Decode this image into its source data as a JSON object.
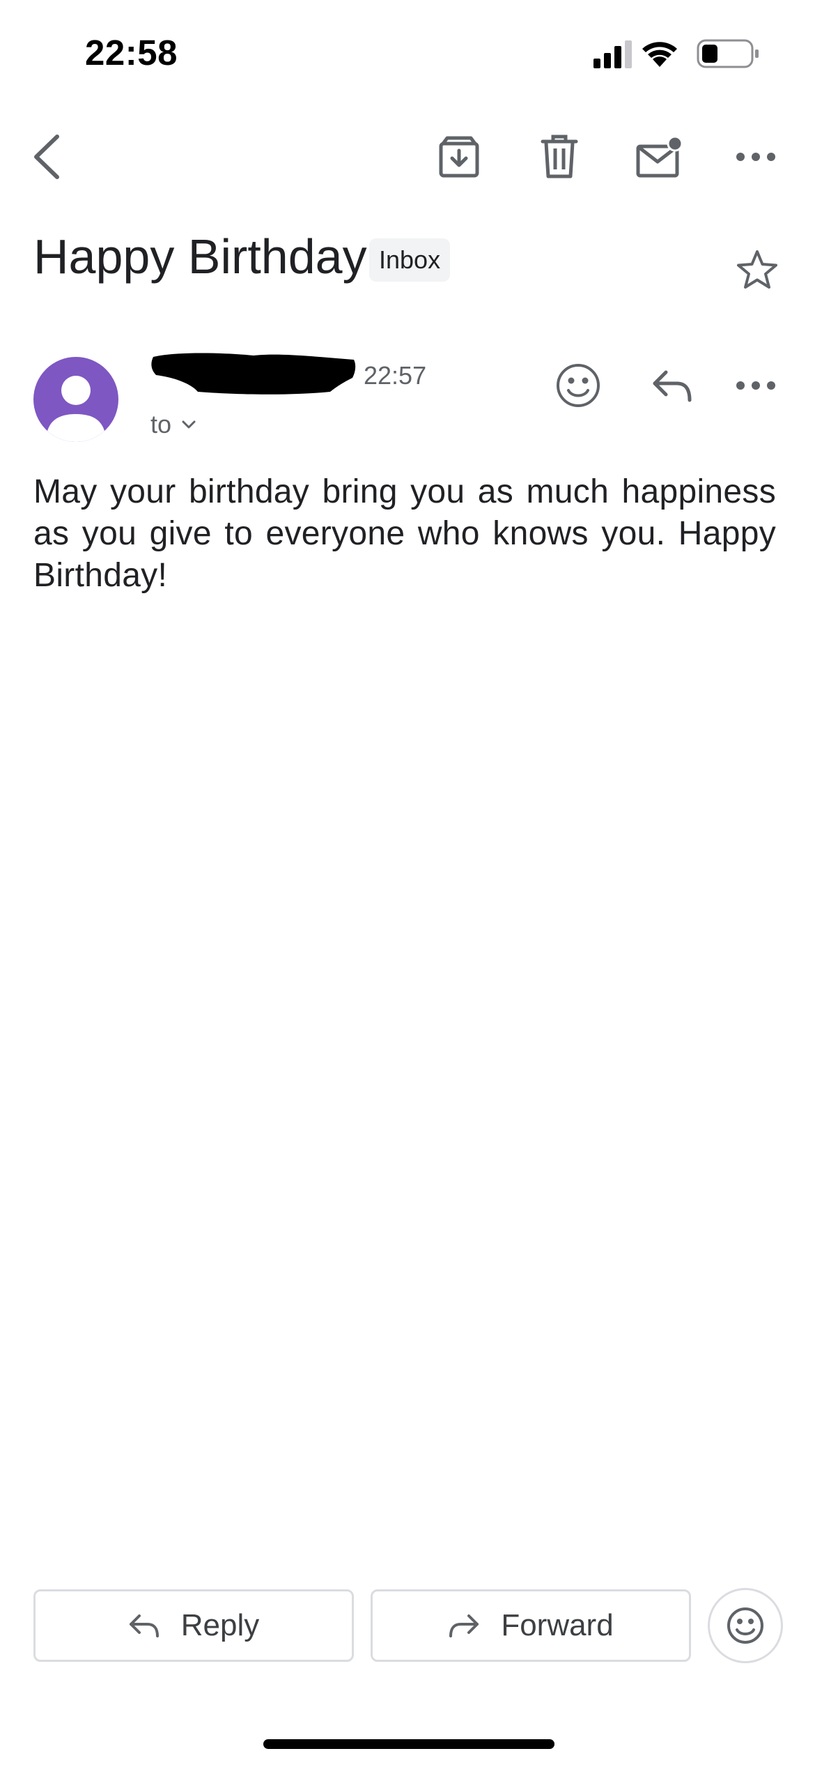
{
  "status_bar": {
    "time": "22:58"
  },
  "toolbar": {
    "back_icon": "chevron-left-icon",
    "archive_icon": "archive-icon",
    "delete_icon": "trash-icon",
    "mark_unread_icon": "mail-unread-icon",
    "more_icon": "more-horizontal-icon"
  },
  "email": {
    "subject": "Happy Birthday",
    "label": "Inbox",
    "time": "22:57",
    "to_label": "to",
    "body": "May your birthday bring you as much happiness as you give to everyone who knows you. Happy Birthday!"
  },
  "actions": {
    "reply_label": "Reply",
    "forward_label": "Forward"
  },
  "colors": {
    "avatar": "#7e57c2",
    "icon_gray": "#5f6368",
    "border": "#dadce0"
  }
}
